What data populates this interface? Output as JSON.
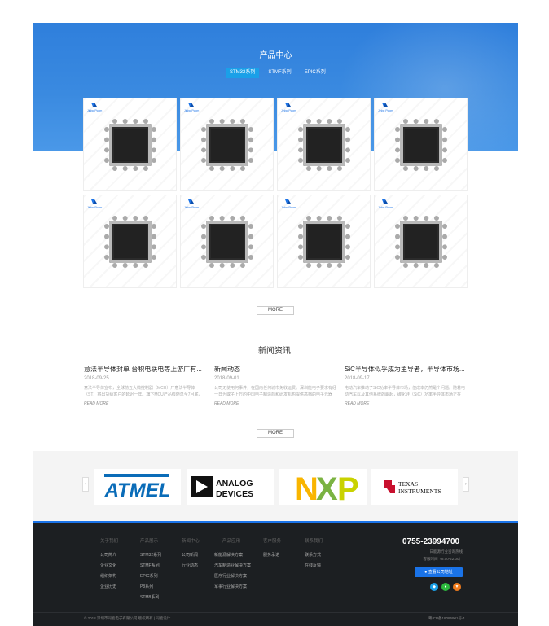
{
  "products": {
    "title": "产品中心",
    "tabs": [
      "STM32系列",
      "STMF系列",
      "EPIC系列"
    ],
    "active_tab": 0,
    "brand_mark": "Jinbo Pcom",
    "items": 8,
    "more_label": "MORE"
  },
  "news": {
    "title": "新闻资讯",
    "items": [
      {
        "title": "意法半导体封单 台积电联电等上游厂有...",
        "date": "2018-09-25",
        "summary": "意法半导体宣布，全球前五大微控制器（MCU）厂意法半导体（ST）将出货给客户的延迟一年。旗下MCU产品线随单至7月底，您需有好...",
        "read_more": "READ MORE"
      },
      {
        "title": "新闻动态",
        "date": "2018-09-01",
        "summary": "公司无使用何事件，在国内任何城市免收运费。深圳能电子要求有经一日为或子上万的中国电子制造商和研发机构提供高档的电子元器件。",
        "read_more": "READ MORE"
      },
      {
        "title": "SiC半导体似乎成为主导者，半导体市场...",
        "date": "2018-09-17",
        "summary": "电动汽车推动了SiC功率半导体市场，但成本仍然是个问题。随着电动汽车以及其他系统的崛起，碳化硅（SiC）功率半导体市场正在经...",
        "read_more": "READ MORE"
      }
    ],
    "more_label": "MORE"
  },
  "partners": {
    "prev": "‹",
    "next": "›",
    "logos": [
      "ATMEL",
      "ANALOG DEVICES",
      "NXP",
      "TEXAS INSTRUMENTS"
    ]
  },
  "footer": {
    "columns": [
      {
        "head": "关于我们",
        "items": [
          "公司简介",
          "企业文化",
          "组织架构",
          "企业历史"
        ]
      },
      {
        "head": "产品展示",
        "items": [
          "STM32系列",
          "STMF系列",
          "EPIC系列",
          "P8系列",
          "STM8系列"
        ]
      },
      {
        "head": "新闻中心",
        "items": [
          "公司新闻",
          "行业动态"
        ]
      },
      {
        "head": "产品应用",
        "items": [
          "新能源解决方案",
          "汽车制造业解决方案",
          "医疗行业解决方案",
          "军事行业解决方案"
        ]
      },
      {
        "head": "客户服务",
        "items": [
          "服务承诺"
        ]
      },
      {
        "head": "联系我们",
        "items": [
          "联系方式",
          "在线反馈"
        ]
      }
    ],
    "phone": "0755-23994700",
    "hotline_label": "日能源行业咨询热线",
    "hours": "客服时间（8:00-22:00）",
    "map_button": "查看公司地址",
    "copyright": "© 2018 深圳市同能电子有限公司 版权所有 | 同能设计",
    "icp": "粤ICP备18086901号-1"
  }
}
